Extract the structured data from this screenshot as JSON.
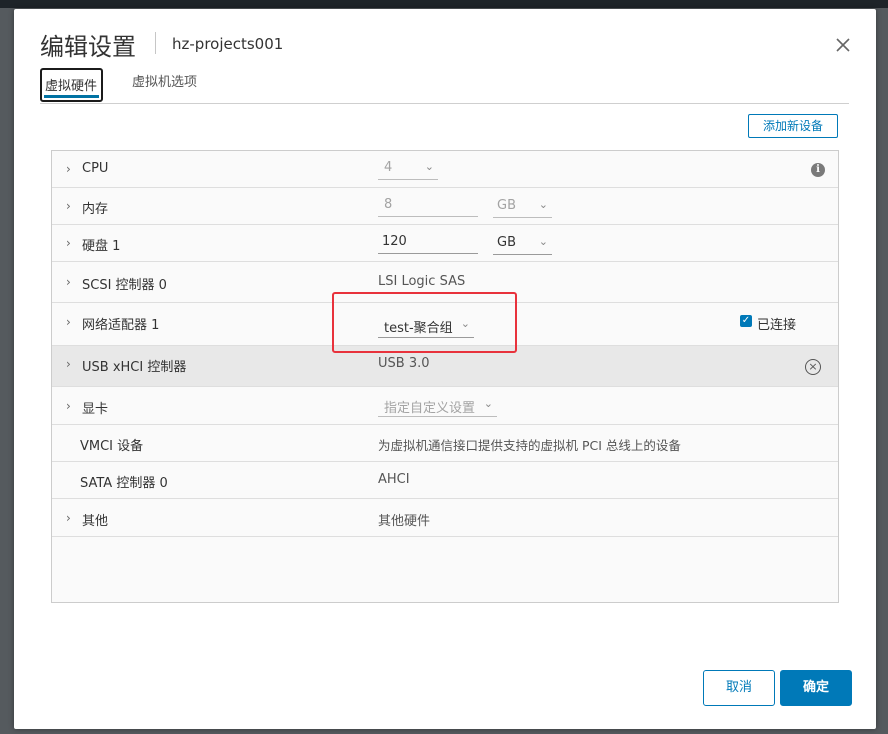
{
  "dialog": {
    "title": "编辑设置",
    "subtitle": "hz-projects001"
  },
  "tabs": [
    {
      "label": "虚拟硬件",
      "active": true
    },
    {
      "label": "虚拟机选项",
      "active": false
    }
  ],
  "toolbar": {
    "add_device_label": "添加新设备"
  },
  "hardware": {
    "cpu": {
      "label": "CPU",
      "value": "4"
    },
    "memory": {
      "label": "内存",
      "value": "8",
      "unit": "GB"
    },
    "disk": {
      "label": "硬盘 1",
      "value": "120",
      "unit": "GB"
    },
    "scsi": {
      "label": "SCSI 控制器 0",
      "value": "LSI Logic SAS"
    },
    "network": {
      "label": "网络适配器 1",
      "value": "test-聚合组",
      "connected_label": "已连接",
      "connected": true
    },
    "usb": {
      "label": "USB xHCI 控制器",
      "value": "USB 3.0"
    },
    "video": {
      "label": "显卡",
      "value": "指定自定义设置"
    },
    "vmci": {
      "label": "VMCI 设备",
      "value": "为虚拟机通信接口提供支持的虚拟机 PCI 总线上的设备"
    },
    "sata": {
      "label": "SATA 控制器 0",
      "value": "AHCI"
    },
    "other": {
      "label": "其他",
      "value": "其他硬件"
    }
  },
  "footer": {
    "cancel_label": "取消",
    "ok_label": "确定"
  },
  "colors": {
    "accent": "#0079b8",
    "highlight_box": "#e8323c"
  },
  "icons": [
    "close-icon",
    "chevron-right-icon",
    "chevron-down-icon",
    "info-icon",
    "remove-circle-icon",
    "checkbox-checked-icon"
  ]
}
